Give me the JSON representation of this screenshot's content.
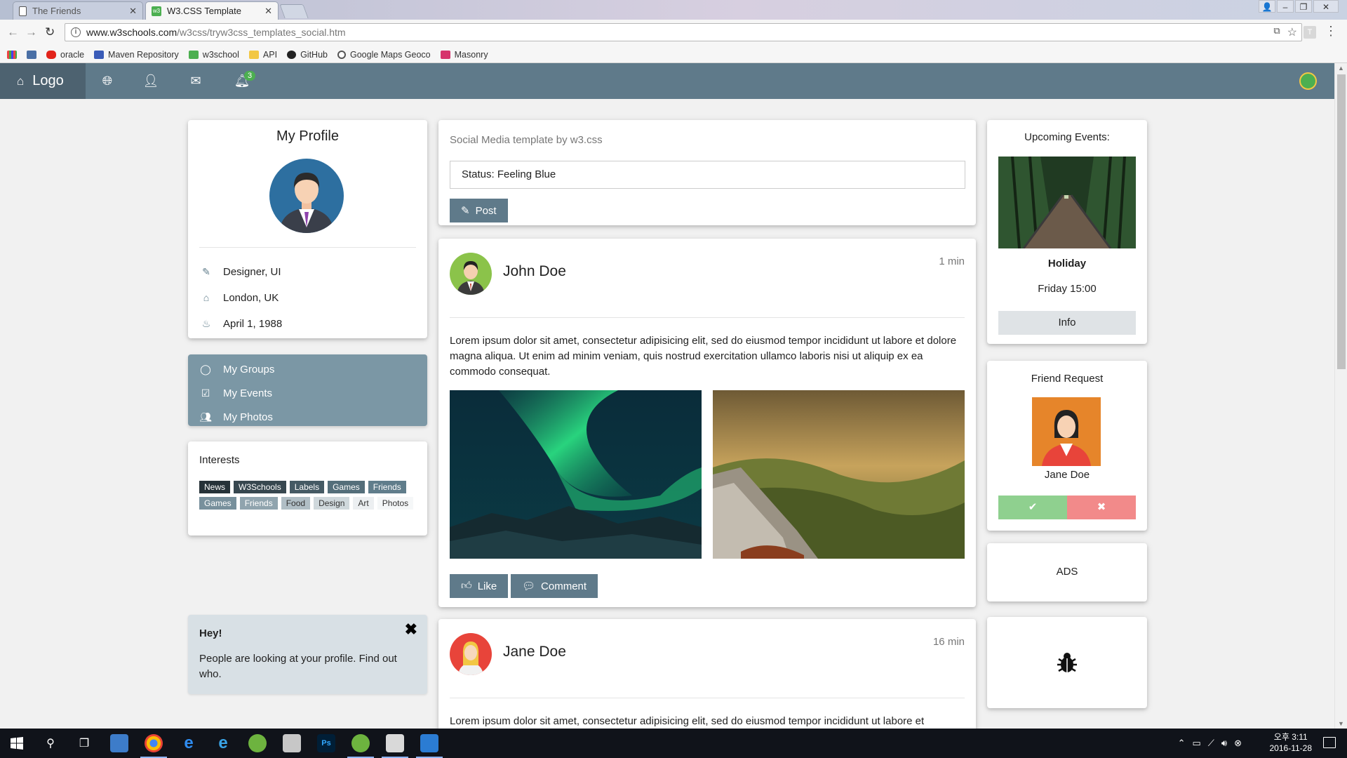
{
  "browser": {
    "tabs": [
      {
        "title": "The Friends",
        "active": false
      },
      {
        "title": "W3.CSS Template",
        "active": true
      }
    ],
    "url_host": "www.w3schools.com",
    "url_path": "/w3css/tryw3css_templates_social.htm",
    "bookmarks": [
      "oracle",
      "Maven Repository",
      "w3school",
      "API",
      "GitHub",
      "Google Maps Geoco",
      "Masonry"
    ]
  },
  "navbar": {
    "logo": "Logo",
    "notification_count": "3"
  },
  "profile": {
    "title": "My Profile",
    "job": "Designer, UI",
    "location": "London, UK",
    "birthday": "April 1, 1988"
  },
  "accordion": {
    "groups": "My Groups",
    "events": "My Events",
    "photos": "My Photos"
  },
  "interests": {
    "title": "Interests",
    "tags": [
      {
        "label": "News",
        "color": "#263238",
        "text": "#ffffff"
      },
      {
        "label": "W3Schools",
        "color": "#37474f",
        "text": "#ffffff"
      },
      {
        "label": "Labels",
        "color": "#455a64",
        "text": "#ffffff"
      },
      {
        "label": "Games",
        "color": "#546e7a",
        "text": "#ffffff"
      },
      {
        "label": "Friends",
        "color": "#607d8b",
        "text": "#ffffff"
      },
      {
        "label": "Games",
        "color": "#78909c",
        "text": "#ffffff"
      },
      {
        "label": "Friends",
        "color": "#90a4ae",
        "text": "#ffffff"
      },
      {
        "label": "Food",
        "color": "#b0bec5",
        "text": "#333333"
      },
      {
        "label": "Design",
        "color": "#cfd8dc",
        "text": "#333333"
      },
      {
        "label": "Art",
        "color": "#eceff1",
        "text": "#333333"
      },
      {
        "label": "Photos",
        "color": "#f5f7f8",
        "text": "#333333"
      }
    ]
  },
  "alert": {
    "title": "Hey!",
    "text": "People are looking at your profile. Find out who."
  },
  "status": {
    "caption": "Social Media template by w3.css",
    "value": "Status: Feeling Blue",
    "post_label": "Post"
  },
  "posts": [
    {
      "author": "John Doe",
      "time": "1 min",
      "body": "Lorem ipsum dolor sit amet, consectetur adipisicing elit, sed do eiusmod tempor incididunt ut labore et dolore magna aliqua. Ut enim ad minim veniam, quis nostrud exercitation ullamco laboris nisi ut aliquip ex ea commodo consequat.",
      "like_label": "Like",
      "comment_label": "Comment"
    },
    {
      "author": "Jane Doe",
      "time": "16 min",
      "body": "Lorem ipsum dolor sit amet, consectetur adipisicing elit, sed do eiusmod tempor incididunt ut labore et"
    }
  ],
  "events": {
    "title": "Upcoming Events:",
    "name": "Holiday",
    "when": "Friday 15:00",
    "info_label": "Info"
  },
  "friend_request": {
    "title": "Friend Request",
    "name": "Jane Doe"
  },
  "ads": {
    "label": "ADS"
  },
  "taskbar": {
    "time": "오후 3:11",
    "date": "2016-11-28"
  }
}
